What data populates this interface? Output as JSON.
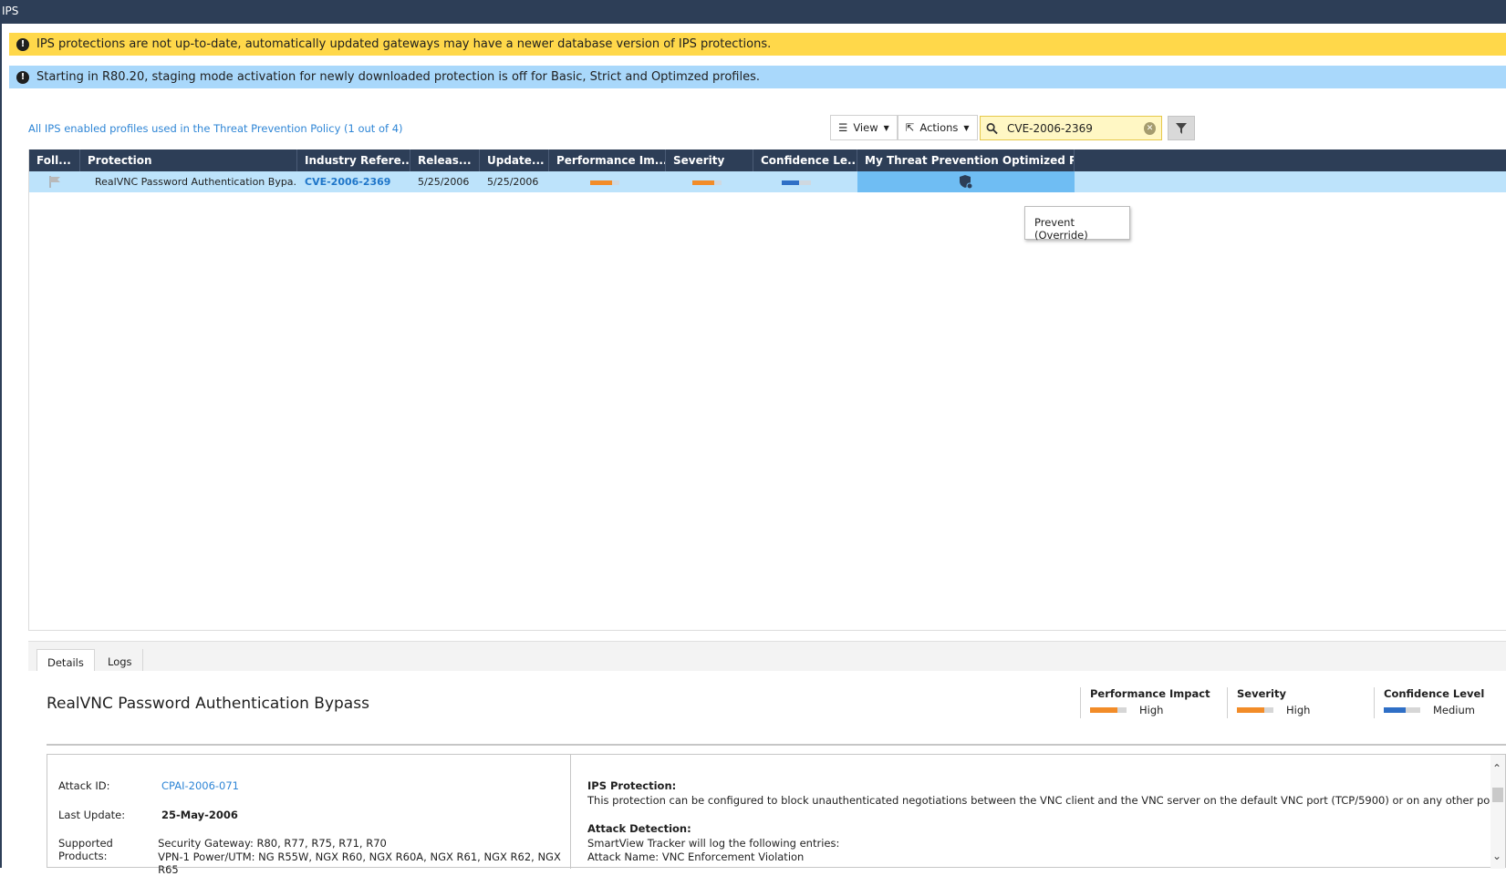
{
  "window": {
    "title": "IPS"
  },
  "banners": {
    "warning": "IPS protections are not up-to-date, automatically updated gateways may have a newer database version of IPS protections.",
    "info": "Starting in R80.20, staging mode activation for newly downloaded protection is off for Basic, Strict and Optimzed profiles."
  },
  "profiles_link": "All IPS enabled profiles used in the Threat Prevention Policy (1 out of 4)",
  "toolbar": {
    "view_label": "View",
    "actions_label": "Actions"
  },
  "search": {
    "value": "CVE-2006-2369"
  },
  "grid": {
    "columns": [
      "Foll...",
      "Protection",
      "Industry Refere...",
      "Releas...",
      "Update...",
      "Performance Im...",
      "Severity",
      "Confidence Le...",
      "My Threat Prevention Optimized Profile"
    ],
    "rows": [
      {
        "protection": "RealVNC Password Authentication Bypa...",
        "industry_reference": "CVE-2006-2369",
        "release": "5/25/2006",
        "update": "5/25/2006",
        "performance_level": 0.75,
        "severity_level": 0.75,
        "confidence_level": 0.6
      }
    ],
    "tooltip": "Prevent (Override)"
  },
  "tabs": {
    "details": "Details",
    "logs": "Logs"
  },
  "details": {
    "title": "RealVNC Password Authentication Bypass",
    "meters": {
      "performance": {
        "label": "Performance Impact",
        "value": "High",
        "level": 0.75
      },
      "severity": {
        "label": "Severity",
        "value": "High",
        "level": 0.75
      },
      "confidence": {
        "label": "Confidence Level",
        "value": "Medium",
        "level": 0.6
      }
    },
    "attack_id_label": "Attack ID:",
    "attack_id": "CPAI-2006-071",
    "last_update_label": "Last Update:",
    "last_update": "25-May-2006",
    "supported_label": "Supported Products:",
    "supported_line1": "Security Gateway: R80, R77, R75, R71, R70",
    "supported_line2": "VPN-1 Power/UTM: NG R55W, NGX R60, NGX R60A, NGX R61, NGX R62, NGX R65",
    "ips_protection_heading": "IPS Protection:",
    "ips_protection_text": "This protection can be configured to block unauthenticated negotiations between the VNC client and the VNC server on the default VNC port (TCP/5900) or on any other port",
    "attack_detection_heading": "Attack Detection:",
    "attack_detection_text": "SmartView Tracker will log the following entries:",
    "attack_name_text": "Attack Name: VNC Enforcement Violation"
  },
  "colors": {
    "header_bg": "#2d3e57",
    "warning": "#ffd84a",
    "info": "#a9d8fb",
    "orange": "#f28c28",
    "blue": "#2f6fc6",
    "row_selected": "#bde3fb",
    "profile_cell": "#6fbdf3"
  }
}
